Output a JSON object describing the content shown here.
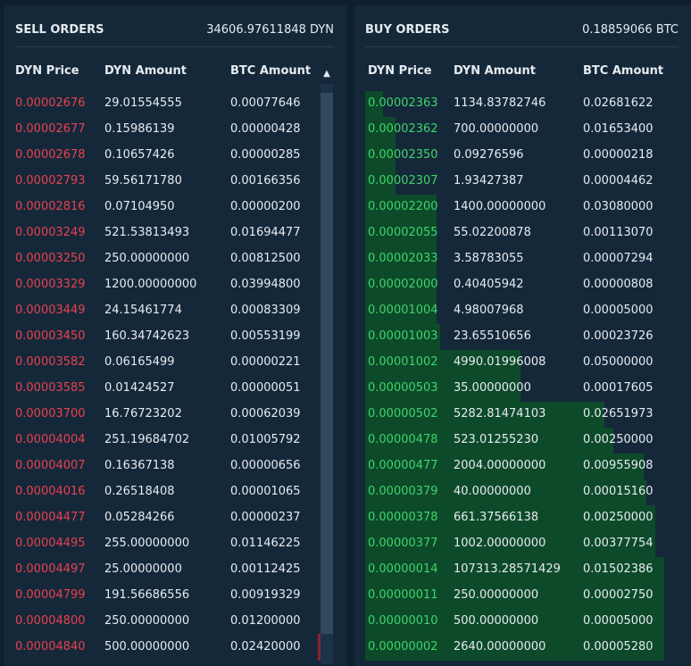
{
  "sell": {
    "title": "SELL ORDERS",
    "total": "34606.97611848 DYN",
    "headers": [
      "DYN Price",
      "DYN Amount",
      "BTC Amount"
    ],
    "rows": [
      {
        "price": "0.00002676",
        "dyn": "29.01554555",
        "btc": "0.00077646"
      },
      {
        "price": "0.00002677",
        "dyn": "0.15986139",
        "btc": "0.00000428"
      },
      {
        "price": "0.00002678",
        "dyn": "0.10657426",
        "btc": "0.00000285"
      },
      {
        "price": "0.00002793",
        "dyn": "59.56171780",
        "btc": "0.00166356"
      },
      {
        "price": "0.00002816",
        "dyn": "0.07104950",
        "btc": "0.00000200"
      },
      {
        "price": "0.00003249",
        "dyn": "521.53813493",
        "btc": "0.01694477"
      },
      {
        "price": "0.00003250",
        "dyn": "250.00000000",
        "btc": "0.00812500"
      },
      {
        "price": "0.00003329",
        "dyn": "1200.00000000",
        "btc": "0.03994800"
      },
      {
        "price": "0.00003449",
        "dyn": "24.15461774",
        "btc": "0.00083309"
      },
      {
        "price": "0.00003450",
        "dyn": "160.34742623",
        "btc": "0.00553199"
      },
      {
        "price": "0.00003582",
        "dyn": "0.06165499",
        "btc": "0.00000221"
      },
      {
        "price": "0.00003585",
        "dyn": "0.01424527",
        "btc": "0.00000051"
      },
      {
        "price": "0.00003700",
        "dyn": "16.76723202",
        "btc": "0.00062039"
      },
      {
        "price": "0.00004004",
        "dyn": "251.19684702",
        "btc": "0.01005792"
      },
      {
        "price": "0.00004007",
        "dyn": "0.16367138",
        "btc": "0.00000656"
      },
      {
        "price": "0.00004016",
        "dyn": "0.26518408",
        "btc": "0.00001065"
      },
      {
        "price": "0.00004477",
        "dyn": "0.05284266",
        "btc": "0.00000237"
      },
      {
        "price": "0.00004495",
        "dyn": "255.00000000",
        "btc": "0.01146225"
      },
      {
        "price": "0.00004497",
        "dyn": "25.00000000",
        "btc": "0.00112425"
      },
      {
        "price": "0.00004799",
        "dyn": "191.56686556",
        "btc": "0.00919329"
      },
      {
        "price": "0.00004800",
        "dyn": "250.00000000",
        "btc": "0.01200000"
      },
      {
        "price": "0.00004840",
        "dyn": "500.00000000",
        "btc": "0.02420000"
      }
    ]
  },
  "buy": {
    "title": "BUY ORDERS",
    "total": "0.18859066 BTC",
    "headers": [
      "DYN Price",
      "DYN Amount",
      "BTC Amount"
    ],
    "rows": [
      {
        "price": "0.00002363",
        "dyn": "1134.83782746",
        "btc": "0.02681622",
        "depth": 0.06
      },
      {
        "price": "0.00002362",
        "dyn": "700.00000000",
        "btc": "0.01653400",
        "depth": 0.1
      },
      {
        "price": "0.00002350",
        "dyn": "0.09276596",
        "btc": "0.00000218",
        "depth": 0.1
      },
      {
        "price": "0.00002307",
        "dyn": "1.93427387",
        "btc": "0.00004462",
        "depth": 0.1
      },
      {
        "price": "0.00002200",
        "dyn": "1400.00000000",
        "btc": "0.03080000",
        "depth": 0.24
      },
      {
        "price": "0.00002055",
        "dyn": "55.02200878",
        "btc": "0.00113070",
        "depth": 0.24
      },
      {
        "price": "0.00002033",
        "dyn": "3.58783055",
        "btc": "0.00007294",
        "depth": 0.24
      },
      {
        "price": "0.00002000",
        "dyn": "0.40405942",
        "btc": "0.00000808",
        "depth": 0.24
      },
      {
        "price": "0.00001004",
        "dyn": "4.98007968",
        "btc": "0.00005000",
        "depth": 0.24
      },
      {
        "price": "0.00001003",
        "dyn": "23.65510656",
        "btc": "0.00023726",
        "depth": 0.25
      },
      {
        "price": "0.00001002",
        "dyn": "4990.01996008",
        "btc": "0.05000000",
        "depth": 0.52
      },
      {
        "price": "0.00000503",
        "dyn": "35.00000000",
        "btc": "0.00017605",
        "depth": 0.52
      },
      {
        "price": "0.00000502",
        "dyn": "5282.81474103",
        "btc": "0.02651973",
        "depth": 0.8
      },
      {
        "price": "0.00000478",
        "dyn": "523.01255230",
        "btc": "0.00250000",
        "depth": 0.83
      },
      {
        "price": "0.00000477",
        "dyn": "2004.00000000",
        "btc": "0.00955908",
        "depth": 0.93
      },
      {
        "price": "0.00000379",
        "dyn": "40.00000000",
        "btc": "0.00015160",
        "depth": 0.94
      },
      {
        "price": "0.00000378",
        "dyn": "661.37566138",
        "btc": "0.00250000",
        "depth": 0.97
      },
      {
        "price": "0.00000377",
        "dyn": "1002.00000000",
        "btc": "0.00377754",
        "depth": 0.97
      },
      {
        "price": "0.00000014",
        "dyn": "107313.28571429",
        "btc": "0.01502386",
        "depth": 1.0
      },
      {
        "price": "0.00000011",
        "dyn": "250.00000000",
        "btc": "0.00002750",
        "depth": 1.0
      },
      {
        "price": "0.00000010",
        "dyn": "500.00000000",
        "btc": "0.00005000",
        "depth": 1.0
      },
      {
        "price": "0.00000002",
        "dyn": "2640.00000000",
        "btc": "0.00005280",
        "depth": 1.0
      }
    ]
  },
  "colors": {
    "sell_price": "#e8414f",
    "buy_price": "#3fd46a",
    "depth_bar": "#0d4a2a",
    "panel_bg": "#15283a"
  },
  "icons": {
    "scroll_up": "chevron-up-icon"
  }
}
